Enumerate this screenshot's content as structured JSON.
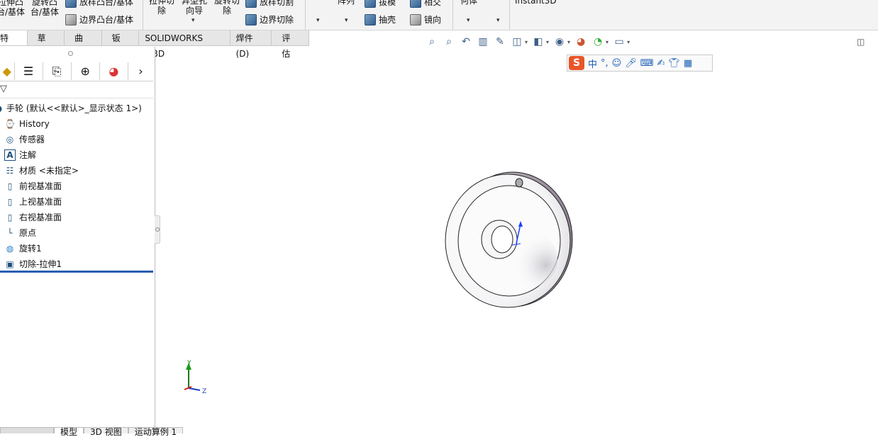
{
  "ribbon": {
    "extrude_boss": "拉伸凸台/基体",
    "revolve_boss": "旋转凸台/基体",
    "loft_boss": "放样凸台/基体",
    "boundary_boss": "边界凸台/基体",
    "extrude_cut": "拉伸切除",
    "hole_wizard": "异型孔向导",
    "revolve_cut": "旋转切除",
    "loft_cut": "放样切割",
    "boundary_cut": "边界切除",
    "pattern": "阵列",
    "draft": "拔模",
    "intersect": "相交",
    "shell": "抽壳",
    "mirror": "镜向",
    "ref_geometry": "参考几何体",
    "instant3d": "Instant3D"
  },
  "tabs": [
    "特征",
    "草图",
    "曲面",
    "钣金",
    "SOLIDWORKS MBD",
    "焊件(D)",
    "评估"
  ],
  "ime": {
    "logo": "S",
    "lang": "中",
    "punct": "°,"
  },
  "feature_tree": {
    "root": "手轮  (默认<<默认>_显示状态 1>)",
    "items": [
      {
        "label": "History",
        "icon": "history-icon"
      },
      {
        "label": "传感器",
        "icon": "sensor-icon"
      },
      {
        "label": "注解",
        "icon": "annotation-icon"
      },
      {
        "label": "材质 <未指定>",
        "icon": "material-icon"
      },
      {
        "label": "前视基准面",
        "icon": "plane-icon"
      },
      {
        "label": "上视基准面",
        "icon": "plane-icon"
      },
      {
        "label": "右视基准面",
        "icon": "plane-icon"
      },
      {
        "label": "原点",
        "icon": "origin-icon"
      },
      {
        "label": "旋转1",
        "icon": "revolve-icon"
      },
      {
        "label": "切除-拉伸1",
        "icon": "cut-extrude-icon"
      }
    ]
  },
  "bottom_tabs": [
    "模型",
    "3D 视图",
    "运动算例 1"
  ],
  "triad": {
    "y": "Y",
    "z": "Z"
  }
}
